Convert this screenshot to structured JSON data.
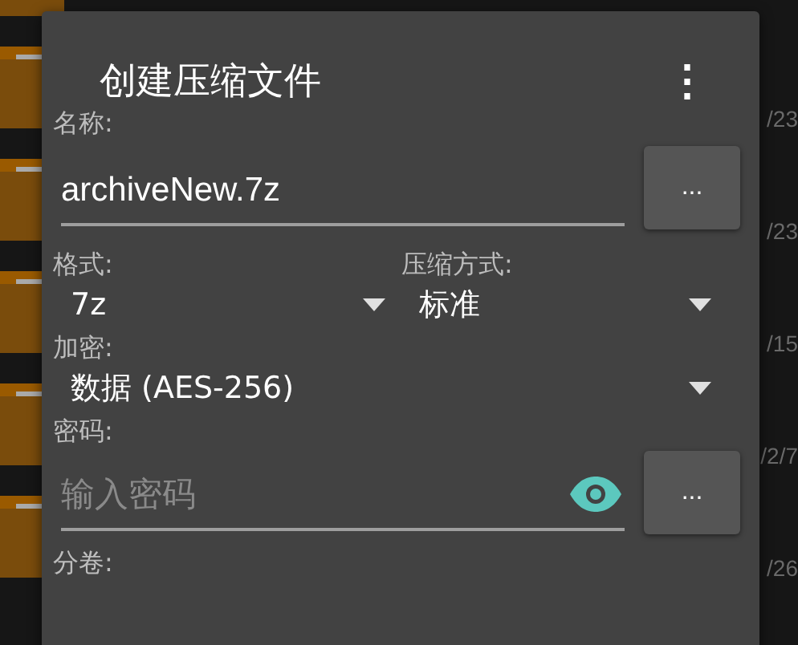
{
  "background_list": {
    "rows": [
      {},
      {
        "date": "/23"
      },
      {
        "date": "/23"
      },
      {
        "date": "/15"
      },
      {
        "date": "/2/7"
      },
      {
        "date": "/26"
      }
    ]
  },
  "dialog": {
    "title": "创建压缩文件",
    "menu_icon": "⋮",
    "name": {
      "label": "名称:",
      "value": "archiveNew.7z",
      "button": "..."
    },
    "format": {
      "label": "格式:",
      "value": "7z"
    },
    "compression": {
      "label": "压缩方式:",
      "value": "标准"
    },
    "encryption": {
      "label": "加密:",
      "value": "数据 (AES-256)"
    },
    "password": {
      "label": "密码:",
      "placeholder": "输入密码",
      "button": "..."
    },
    "split": {
      "label": "分卷:"
    }
  }
}
